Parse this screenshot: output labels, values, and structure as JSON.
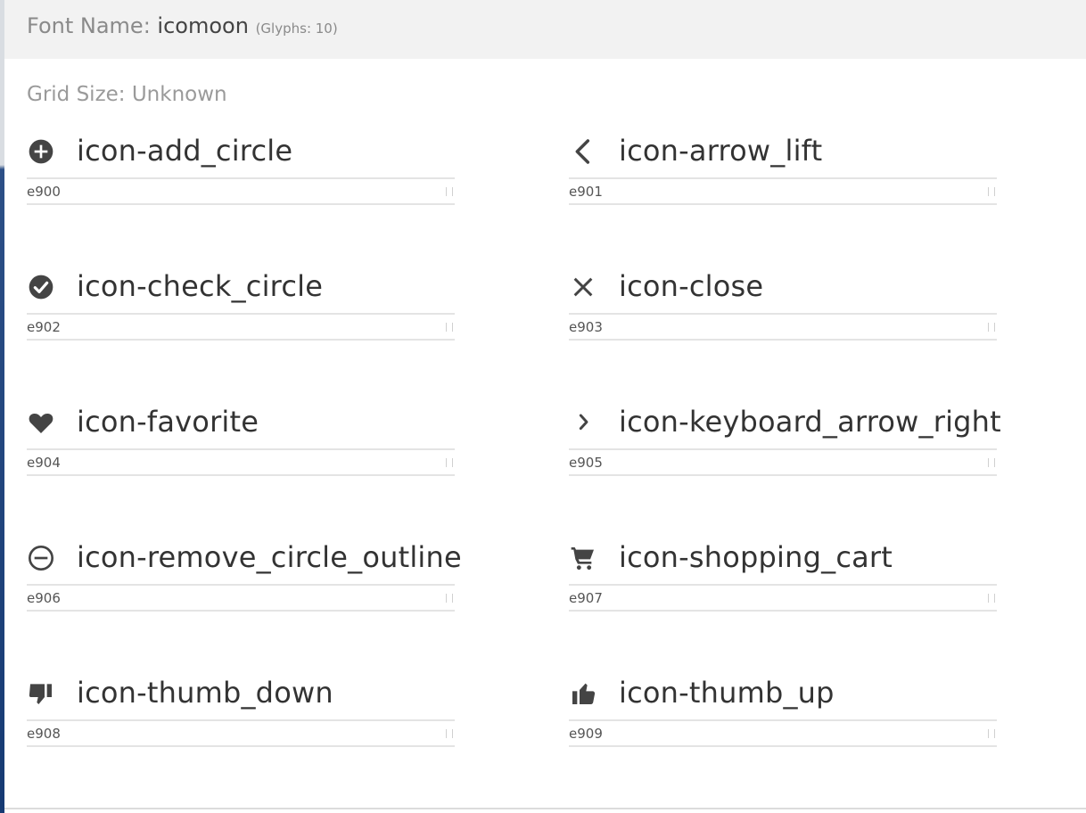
{
  "header": {
    "font_label": "Font Name:",
    "font_name": "icomoon",
    "glyph_count": "(Glyphs: 10)"
  },
  "grid_size": "Grid Size: Unknown",
  "glyphs": [
    {
      "name": "icon-add_circle",
      "code": "e900",
      "icon": "add-circle-icon"
    },
    {
      "name": "icon-arrow_lift",
      "code": "e901",
      "icon": "arrow-left-icon"
    },
    {
      "name": "icon-check_circle",
      "code": "e902",
      "icon": "check-circle-icon"
    },
    {
      "name": "icon-close",
      "code": "e903",
      "icon": "close-icon"
    },
    {
      "name": "icon-favorite",
      "code": "e904",
      "icon": "heart-icon"
    },
    {
      "name": "icon-keyboard_arrow_right",
      "code": "e905",
      "icon": "chevron-right-icon"
    },
    {
      "name": "icon-remove_circle_outline",
      "code": "e906",
      "icon": "remove-circle-outline-icon"
    },
    {
      "name": "icon-shopping_cart",
      "code": "e907",
      "icon": "shopping-cart-icon"
    },
    {
      "name": "icon-thumb_down",
      "code": "e908",
      "icon": "thumb-down-icon"
    },
    {
      "name": "icon-thumb_up",
      "code": "e909",
      "icon": "thumb-up-icon"
    }
  ]
}
